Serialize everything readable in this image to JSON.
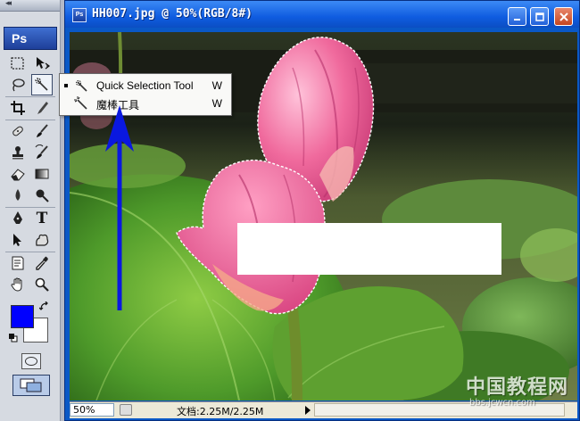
{
  "tools_panel": {
    "collapse_glyph": "◂◂",
    "logo_text": "Ps",
    "tools": [
      {
        "name": "rectangular-marquee-tool-icon"
      },
      {
        "name": "move-tool-icon"
      },
      {
        "name": "lasso-tool-icon"
      },
      {
        "name": "quick-selection-tool-icon",
        "active": true
      },
      {
        "name": "crop-tool-icon"
      },
      {
        "name": "slice-tool-icon"
      },
      {
        "name": "healing-brush-tool-icon"
      },
      {
        "name": "brush-tool-icon"
      },
      {
        "name": "clone-stamp-tool-icon"
      },
      {
        "name": "history-brush-tool-icon"
      },
      {
        "name": "eraser-tool-icon"
      },
      {
        "name": "gradient-tool-icon"
      },
      {
        "name": "blur-tool-icon"
      },
      {
        "name": "dodge-tool-icon"
      },
      {
        "name": "pen-tool-icon"
      },
      {
        "name": "type-tool-icon"
      },
      {
        "name": "path-selection-tool-icon"
      },
      {
        "name": "custom-shape-tool-icon"
      },
      {
        "name": "notes-tool-icon"
      },
      {
        "name": "eyedropper-tool-icon"
      },
      {
        "name": "hand-tool-icon"
      },
      {
        "name": "zoom-tool-icon"
      }
    ],
    "type_tool_glyph": "T",
    "foreground_color": "#0000ff",
    "background_color": "#ffffff"
  },
  "flyout_menu": {
    "items": [
      {
        "label": "Quick Selection Tool",
        "shortcut": "W",
        "selected": true
      },
      {
        "label": "魔棒工具",
        "shortcut": "W",
        "selected": false
      }
    ]
  },
  "document": {
    "title": "HH007.jpg @ 50%(RGB/8#)",
    "icon_text": "Ps",
    "zoom": "50%",
    "doc_size": "文档:2.25M/2.25M"
  },
  "watermark": {
    "text": "中国教程网",
    "url": "bbs.jcwcn.com"
  },
  "colors": {
    "titlebar": "#0f5ce0",
    "annotation_arrow": "#0a18e0",
    "lotus_pink": "#ec5d95",
    "leaf_green": "#4f9a2a"
  }
}
